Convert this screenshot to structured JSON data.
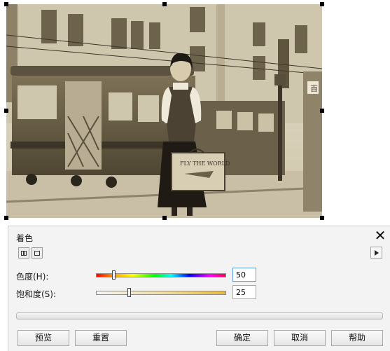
{
  "dialog": {
    "title": "着色",
    "close_glyph": "✕",
    "hue": {
      "label": "色度(H):",
      "value": "50",
      "slider_position": 0.13
    },
    "saturation": {
      "label": "饱和度(S):",
      "value": "25",
      "slider_position": 0.25
    },
    "buttons": {
      "preview": "预览",
      "reset": "重置",
      "ok": "确定",
      "cancel": "取消",
      "help": "帮助"
    }
  },
  "photo": {
    "suitcase_text": "FLY THE WORLD",
    "sign_text": "百"
  },
  "icons": {
    "mode_1": "split-view-icon",
    "mode_2": "single-view-icon",
    "menu": "flyout-menu-arrow-icon",
    "close": "close-icon"
  },
  "colors": {
    "sepia_light": "#d9d2c0",
    "sepia_dark": "#6e6249",
    "focus_border": "#5b9bd5"
  }
}
